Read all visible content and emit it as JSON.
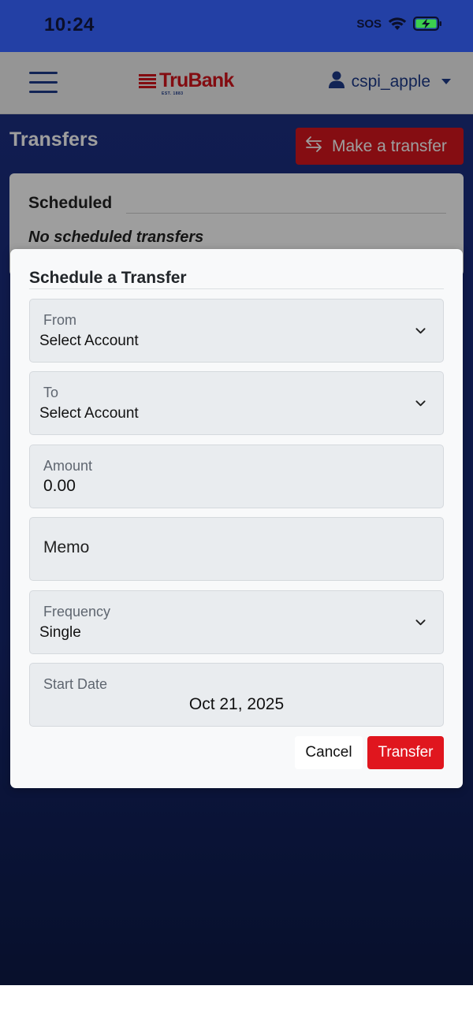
{
  "status_bar": {
    "time": "10:24",
    "sos": "SOS",
    "icons": [
      "wifi-icon",
      "battery-charging-icon"
    ]
  },
  "header": {
    "logo_text": "TruBank",
    "logo_est": "EST. 1883",
    "menu_icon": "hamburger-menu-icon",
    "user_icon": "user-icon",
    "username": "cspi_apple"
  },
  "page": {
    "title": "Transfers",
    "make_transfer_label": "Make a transfer",
    "make_transfer_icon": "swap-arrows-icon"
  },
  "scheduled": {
    "title": "Scheduled",
    "empty_text": "No scheduled transfers"
  },
  "modal": {
    "title": "Schedule a Transfer",
    "from": {
      "label": "From",
      "value": "Select Account"
    },
    "to": {
      "label": "To",
      "value": "Select Account"
    },
    "amount": {
      "label": "Amount",
      "value": "0.00"
    },
    "memo": {
      "placeholder": "Memo"
    },
    "frequency": {
      "label": "Frequency",
      "value": "Single"
    },
    "start_date": {
      "label": "Start Date",
      "value": "Oct 21, 2025"
    },
    "cancel_label": "Cancel",
    "transfer_label": "Transfer"
  },
  "colors": {
    "status_bar": "#2340a5",
    "brand_red": "#d3141c",
    "brand_blue": "#1d3a8a",
    "background_navy": "#1c2f82"
  }
}
